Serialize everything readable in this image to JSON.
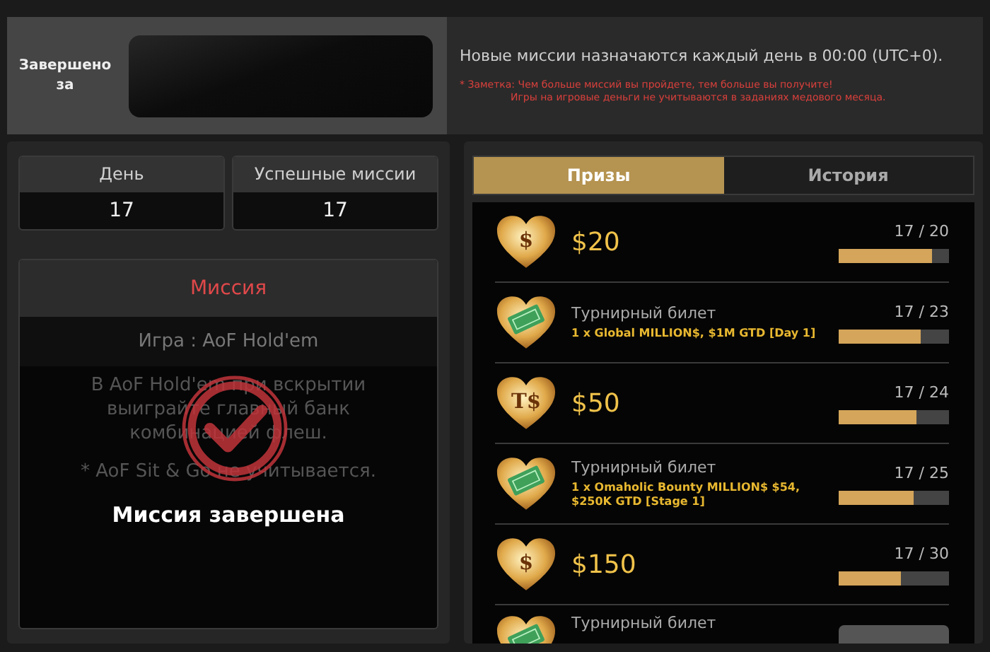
{
  "banner": {
    "completed_label": "Завершено за",
    "info": "Новые миссии назначаются каждый день в 00:00 (UTC+0).",
    "notes": [
      "* Заметка: Чем больше миссий вы пройдете, тем больше вы получите!",
      "Игры на игровые деньги не учитываются в заданиях медового месяца."
    ]
  },
  "stats": [
    {
      "label": "День",
      "value": "17"
    },
    {
      "label": "Успешные миссии",
      "value": "17"
    }
  ],
  "mission": {
    "title": "Миссия",
    "game": "Игра : AoF Hold'em",
    "description": "В AoF Hold'em при вскрытии выиграйте главный банк комбинацией флеш.",
    "note": "* AoF Sit & Go не учитывается.",
    "completed": true,
    "status": "Миссия завершена"
  },
  "tabs": [
    {
      "label": "Призы",
      "selected": true
    },
    {
      "label": "История",
      "selected": false
    }
  ],
  "prizes": [
    {
      "kind": "cash",
      "emblem": "$",
      "amount": "$20",
      "progress": "17 / 20",
      "level": 0.85
    },
    {
      "kind": "ticket",
      "title": "Турнирный билет",
      "detail": "1 x Global MILLION$, $1M GTD [Day 1]",
      "progress": "17 / 23",
      "level": 0.74
    },
    {
      "kind": "cash",
      "emblem": "T$",
      "amount": "$50",
      "progress": "17 / 24",
      "level": 0.71
    },
    {
      "kind": "ticket",
      "title": "Турнирный билет",
      "detail": "1 x Omaholic Bounty MILLION$ $54, $250K GTD [Stage 1]",
      "progress": "17 / 25",
      "level": 0.68
    },
    {
      "kind": "cash",
      "emblem": "$",
      "amount": "$150",
      "progress": "17 / 30",
      "level": 0.57
    },
    {
      "kind": "ticket",
      "title": "Турнирный билет"
    }
  ]
}
